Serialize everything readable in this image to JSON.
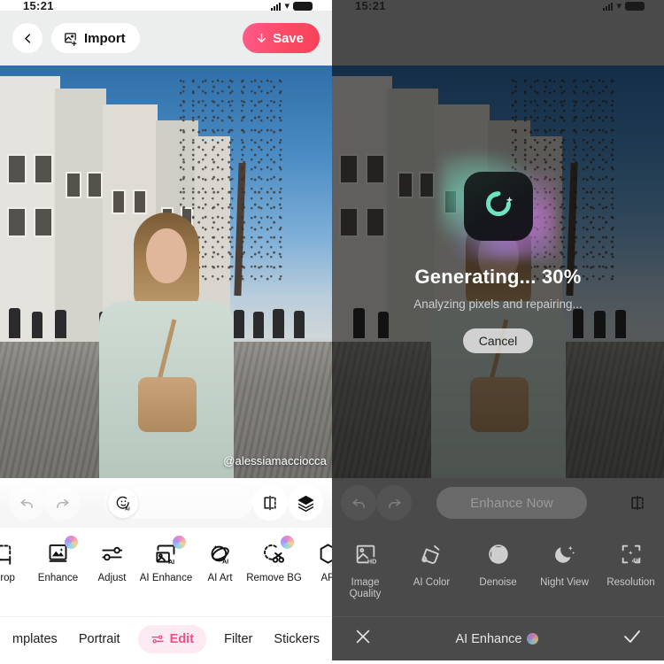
{
  "status_bar": {
    "time": "15:21",
    "wifi_icon": "wifi-icon",
    "signal_icon": "cellular-signal-icon",
    "battery_icon": "battery-icon"
  },
  "left_panel": {
    "top_bar": {
      "back_icon": "chevron-left-icon",
      "import_icon": "image-import-icon",
      "import_label": "Import",
      "save_icon": "download-arrow-icon",
      "save_label": "Save",
      "save_color": "#fb4a63"
    },
    "canvas": {
      "watermark": "@alessiamacciocca"
    },
    "action_row": {
      "undo_icon": "undo-icon",
      "redo_icon": "redo-icon",
      "ai_portrait_icon": "ai-face-icon",
      "compare_icon": "compare-split-icon",
      "layers_icon": "layers-icon"
    },
    "tools": [
      {
        "label": "Crop",
        "icon": "crop-icon",
        "badge": false
      },
      {
        "label": "Enhance",
        "icon": "enhance-icon",
        "badge": true
      },
      {
        "label": "Adjust",
        "icon": "sliders-icon",
        "badge": false
      },
      {
        "label": "AI Enhance",
        "icon": "ai-enhance-icon",
        "badge": true
      },
      {
        "label": "AI Art",
        "icon": "ai-art-icon",
        "badge": false
      },
      {
        "label": "Remove BG",
        "icon": "scissors-icon",
        "badge": true
      },
      {
        "label": "AR",
        "icon": "ar-icon",
        "badge": false
      }
    ],
    "tabs": [
      {
        "label": "mplates",
        "active": false,
        "icon": ""
      },
      {
        "label": "Portrait",
        "active": false,
        "icon": ""
      },
      {
        "label": "Edit",
        "active": true,
        "icon": "sliders-icon"
      },
      {
        "label": "Filter",
        "active": false,
        "icon": ""
      },
      {
        "label": "Stickers",
        "active": false,
        "icon": ""
      }
    ],
    "active_tab_color": "#ef4f87"
  },
  "right_panel": {
    "action_row": {
      "undo_icon": "undo-icon",
      "redo_icon": "redo-icon",
      "enhance_now_label": "Enhance Now",
      "compare_icon": "compare-split-icon"
    },
    "overlay": {
      "logo_icon": "app-logo-camera-icon",
      "title": "Generating... 30%",
      "progress_percent": 30,
      "subtitle": "Analyzing pixels and repairing...",
      "cancel_label": "Cancel"
    },
    "tools": [
      {
        "label": "Image Quality",
        "icon": "image-hd-icon"
      },
      {
        "label": "AI Color",
        "icon": "paint-bucket-icon"
      },
      {
        "label": "Denoise",
        "icon": "denoise-circle-icon"
      },
      {
        "label": "Night View",
        "icon": "moon-stars-icon"
      },
      {
        "label": "Resolution",
        "icon": "resolution-4k-icon"
      }
    ],
    "bottom_bar": {
      "close_icon": "close-x-icon",
      "title": "AI Enhance",
      "title_badge_icon": "ai-sparkle-badge-icon",
      "confirm_icon": "checkmark-icon"
    }
  }
}
